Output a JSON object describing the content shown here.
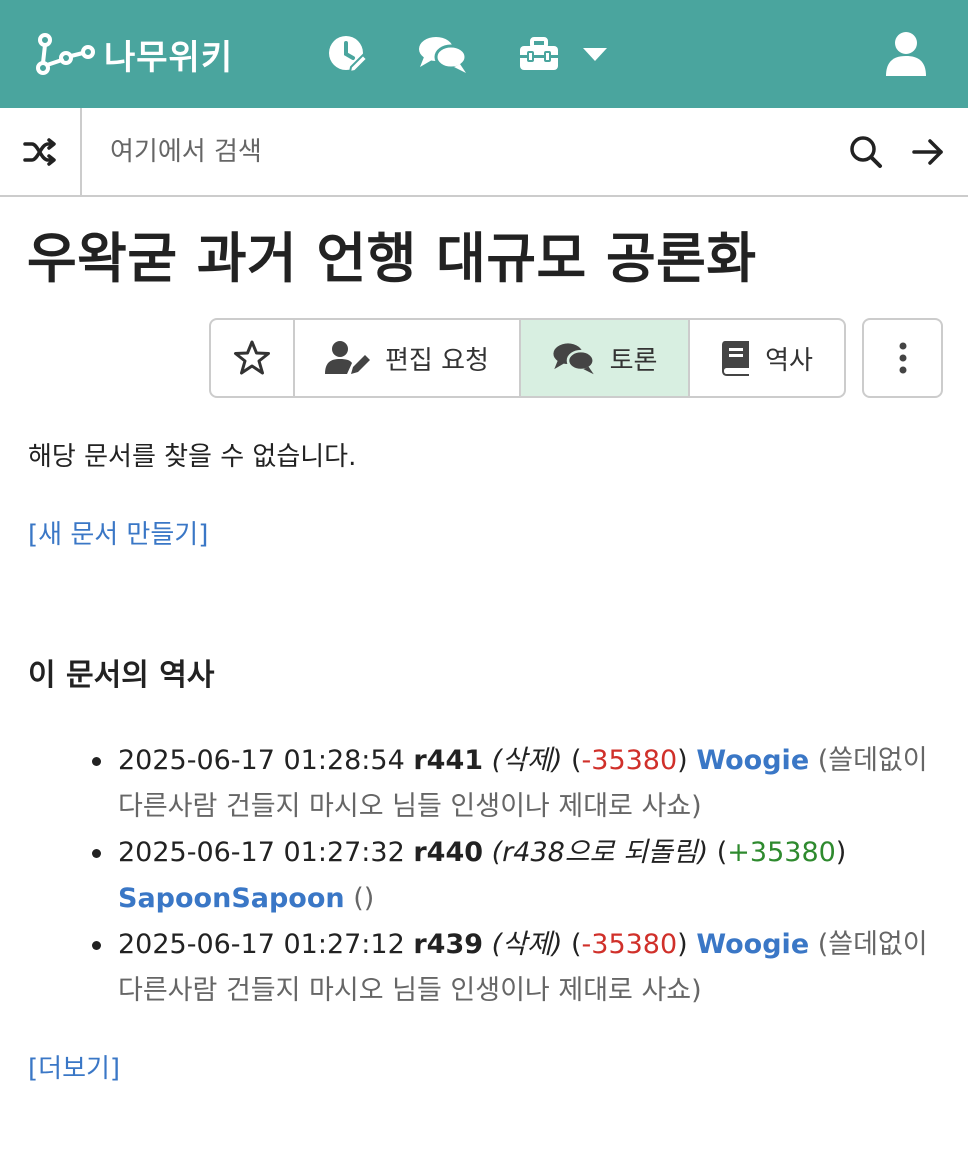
{
  "header": {
    "logo_text": "나무위키",
    "icons": [
      "recent-changes-icon",
      "discussion-icon",
      "tools-icon",
      "caret-down-icon",
      "user-icon"
    ],
    "bg_color": "#4aa59e"
  },
  "search": {
    "placeholder": "여기에서 검색",
    "icons": [
      "shuffle-icon",
      "search-icon",
      "arrow-right-icon"
    ]
  },
  "page": {
    "title": "우왁굳 과거 언행 대규모 공론화",
    "actions": {
      "star_icon": "star-icon",
      "edit_request": "편집 요청",
      "discussion": "토론",
      "history": "역사",
      "more_icon": "vertical-dots-icon"
    },
    "not_found": "해당 문서를 찾을 수 없습니다.",
    "new_doc_link": "[새 문서 만들기]"
  },
  "history": {
    "title": "이 문서의 역사",
    "entries": [
      {
        "time": "2025-06-17 01:28:54",
        "rev": "r441",
        "action": "(삭제)",
        "diff_open": "(",
        "diff": "-35380",
        "diff_close": ")",
        "user": "Woogie",
        "comment": "(쓸데없이 다른사람 건들지 마시오 님들 인생이나 제대로 사쇼)"
      },
      {
        "time": "2025-06-17 01:27:32",
        "rev": "r440",
        "action": "(r438으로 되돌림)",
        "diff_open": "(",
        "diff": "+35380",
        "diff_close": ")",
        "user": "SapoonSapoon",
        "comment": "()"
      },
      {
        "time": "2025-06-17 01:27:12",
        "rev": "r439",
        "action": "(삭제)",
        "diff_open": "(",
        "diff": "-35380",
        "diff_close": ")",
        "user": "Woogie",
        "comment": "(쓸데없이 다른사람 건들지 마시오 님들 인생이나 제대로 사쇼)"
      }
    ],
    "more_link": "[더보기]"
  }
}
